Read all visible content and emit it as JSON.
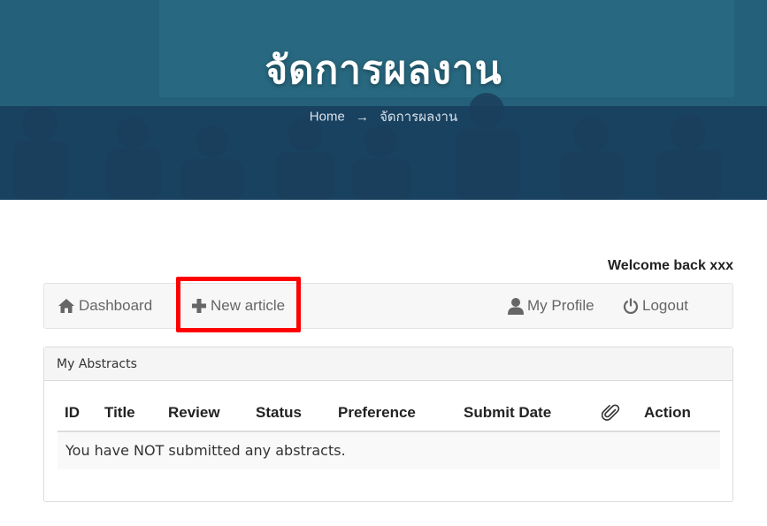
{
  "hero": {
    "title": "จัดการผลงาน",
    "breadcrumb_home": "Home",
    "breadcrumb_arrow": "→",
    "breadcrumb_current": "จัดการผลงาน"
  },
  "welcome": "Welcome back xxx",
  "nav": {
    "dashboard": "Dashboard",
    "new_article": "New article",
    "my_profile": "My Profile",
    "logout": "Logout",
    "icons": {
      "dashboard": "home-icon",
      "new_article": "plus-icon",
      "my_profile": "user-icon",
      "logout": "power-icon"
    }
  },
  "abstracts": {
    "heading": "My Abstracts",
    "columns": [
      "ID",
      "Title",
      "Review",
      "Status",
      "Preference",
      "Submit Date",
      "",
      "Action"
    ],
    "attachment_icon": "paperclip-icon",
    "empty_message": "You have NOT submitted any abstracts."
  },
  "colors": {
    "highlight": "#ff0000",
    "hero_overlay": "#20566e",
    "nav_text": "#666666"
  }
}
